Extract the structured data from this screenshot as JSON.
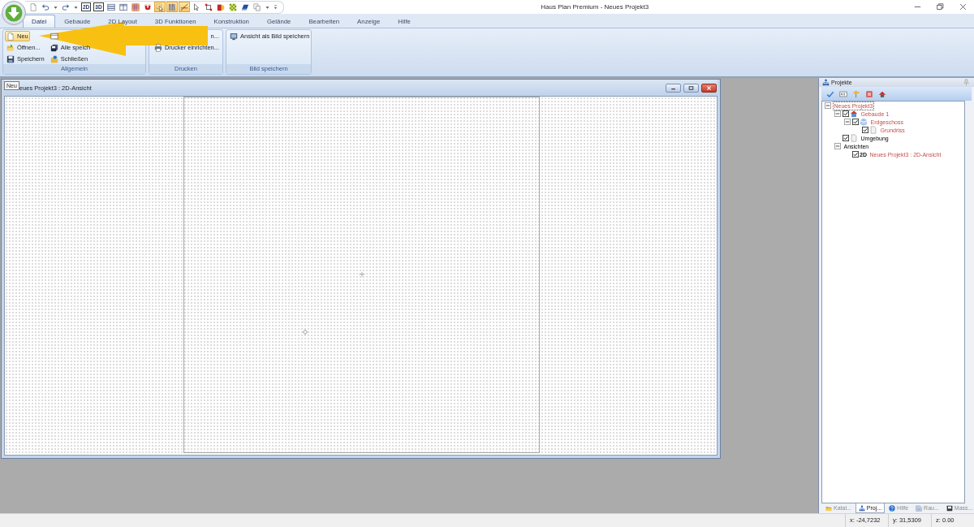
{
  "app": {
    "title": "Haus Plan Premium - Neues Projekt3"
  },
  "quick_access": [
    {
      "kind": "document",
      "on": false
    },
    {
      "kind": "undo",
      "on": false
    },
    {
      "kind": "caret",
      "on": false
    },
    {
      "kind": "redo",
      "on": false
    },
    {
      "kind": "caret",
      "on": false
    },
    {
      "kind": "text",
      "label": "2D",
      "on": false
    },
    {
      "kind": "text",
      "label": "3D",
      "on": false
    },
    {
      "kind": "rows",
      "on": false
    },
    {
      "kind": "columns",
      "on": false
    },
    {
      "kind": "grid",
      "on": false
    },
    {
      "kind": "magnet",
      "on": false
    },
    {
      "kind": "snap",
      "on": true
    },
    {
      "kind": "bars",
      "on": true
    },
    {
      "kind": "angle",
      "on": true
    },
    {
      "kind": "pointer",
      "on": false
    },
    {
      "kind": "frame",
      "on": false
    },
    {
      "kind": "paint",
      "on": false
    },
    {
      "kind": "pattern",
      "on": false
    },
    {
      "kind": "eraser",
      "on": false
    },
    {
      "kind": "copy",
      "on": false
    },
    {
      "kind": "caret",
      "on": false
    },
    {
      "kind": "customize",
      "on": false
    }
  ],
  "tabs": [
    {
      "label": "Datei",
      "selected": true
    },
    {
      "label": "Gebaude",
      "selected": false
    },
    {
      "label": "2D Layout",
      "selected": false
    },
    {
      "label": "3D Funktionen",
      "selected": false
    },
    {
      "label": "Konstruktion",
      "selected": false
    },
    {
      "label": "Gelände",
      "selected": false
    },
    {
      "label": "Bearbeiten",
      "selected": false
    },
    {
      "label": "Anzeige",
      "selected": false
    },
    {
      "label": "Hilfe",
      "selected": false
    }
  ],
  "ribbon": {
    "groups": [
      {
        "label": "Allgemein",
        "columns": [
          [
            {
              "kind": "new",
              "label": "Neu",
              "highlighted": true
            },
            {
              "kind": "open",
              "label": "Öffnen...",
              "highlighted": false
            },
            {
              "kind": "save",
              "label": "Speichern",
              "highlighted": false
            }
          ],
          [
            {
              "kind": "sheet",
              "highlighted": false
            },
            {
              "kind": "save-all",
              "label": "Alle speich",
              "highlighted": false
            },
            {
              "kind": "close",
              "label": "Schließen",
              "highlighted": false
            }
          ]
        ]
      },
      {
        "label": "Drucken",
        "columns": [
          [
            {
              "label": "n...",
              "highlighted": false
            },
            {
              "kind": "printer",
              "label": "Drucker einrichten...",
              "highlighted": false
            }
          ]
        ]
      },
      {
        "label": "Bild speichern",
        "columns": [
          [
            {
              "kind": "picture",
              "label": "Ansicht als Bild speichern",
              "highlighted": false
            }
          ]
        ]
      }
    ]
  },
  "tooltip": {
    "text": "Neu"
  },
  "document_window": {
    "title": "eues Projekt3 : 2D-Ansicht"
  },
  "projects_panel": {
    "title": "Projekte",
    "tree": [
      {
        "label": "Neues Projekt3",
        "active": true,
        "selected": true,
        "expanded": true,
        "children": [
          {
            "label": "Gebaude 1",
            "kind": "building",
            "active": true,
            "selected": false,
            "checked": true,
            "expanded": true,
            "children": [
              {
                "label": "Erdgeschoss",
                "kind": "floor",
                "active": true,
                "selected": false,
                "checked": true,
                "expanded": true,
                "children": [
                  {
                    "label": "Grundriss",
                    "kind": "plan",
                    "active": true,
                    "selected": false,
                    "checked": true
                  }
                ]
              }
            ]
          },
          {
            "label": "Umgebung",
            "kind": "plan",
            "active": false,
            "selected": false,
            "checked": true
          },
          {
            "label": "Ansichten",
            "active": false,
            "selected": false,
            "expanded": true,
            "children": [
              {
                "label": "Neues Projekt3 : 2D-Ansicht",
                "badge": "2D",
                "active": true,
                "selected": false,
                "checked": true
              }
            ]
          }
        ]
      }
    ],
    "tabs": [
      {
        "kind": "catalog",
        "label": "Katal...",
        "selected": false
      },
      {
        "kind": "projects",
        "label": "Proj...",
        "selected": true
      },
      {
        "kind": "help",
        "label": "Hilfe",
        "selected": false
      },
      {
        "kind": "room",
        "label": "Rau...",
        "selected": false
      },
      {
        "kind": "mass",
        "label": "Mass...",
        "selected": false
      }
    ]
  },
  "status_bar": {
    "cells": [
      "x: -24,7232",
      "y: 31,5309",
      "z: 0.00"
    ]
  }
}
